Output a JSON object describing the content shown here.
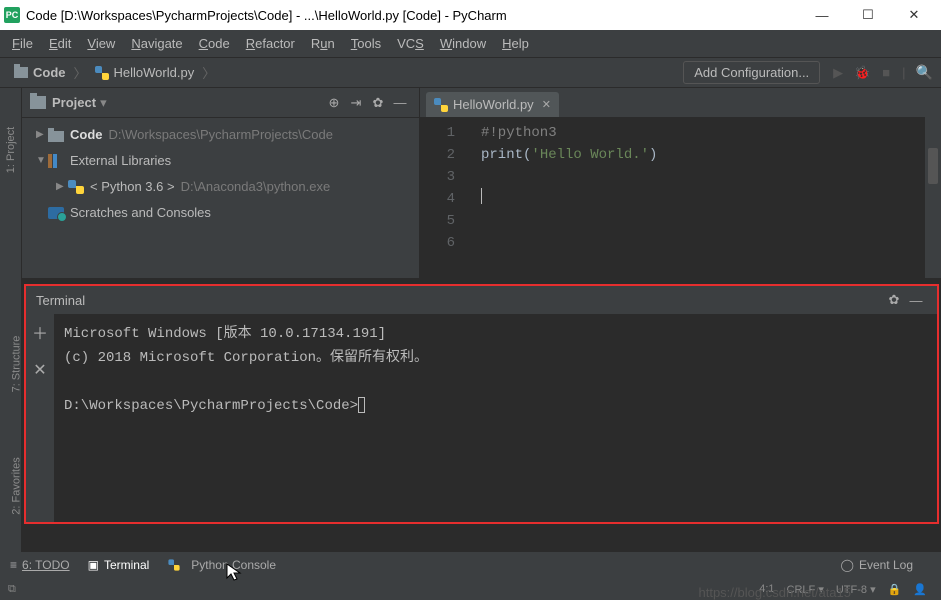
{
  "titlebar": {
    "app_badge": "PC",
    "title": "Code [D:\\Workspaces\\PycharmProjects\\Code] - ...\\HelloWorld.py [Code] - PyCharm"
  },
  "menu": [
    "File",
    "Edit",
    "View",
    "Navigate",
    "Code",
    "Refactor",
    "Run",
    "Tools",
    "VCS",
    "Window",
    "Help"
  ],
  "breadcrumb": {
    "root": "Code",
    "file": "HelloWorld.py"
  },
  "toolbar": {
    "add_config": "Add Configuration..."
  },
  "project_panel": {
    "title": "Project",
    "tree": {
      "root_name": "Code",
      "root_path": "D:\\Workspaces\\PycharmProjects\\Code",
      "ext_lib": "External Libraries",
      "python_env": "< Python 3.6 >",
      "python_path": "D:\\Anaconda3\\python.exe",
      "scratches": "Scratches and Consoles"
    }
  },
  "editor": {
    "tab": "HelloWorld.py",
    "lines": {
      "l1_comment": "#!python3",
      "l2_func": "print",
      "l2_paren_open": "(",
      "l2_str": "'Hello World.'",
      "l2_paren_close": ")"
    },
    "line_numbers": [
      "1",
      "2",
      "3",
      "4",
      "5",
      "6"
    ]
  },
  "terminal": {
    "title": "Terminal",
    "line1": "Microsoft Windows [版本 10.0.17134.191]",
    "line2": "(c) 2018 Microsoft Corporation。保留所有权利。",
    "prompt": "D:\\Workspaces\\PycharmProjects\\Code>"
  },
  "rails": {
    "project": "1: Project",
    "structure": "7: Structure",
    "favorites": "2: Favorites"
  },
  "bottom": {
    "todo": "6: TODO",
    "terminal": "Terminal",
    "pyconsole": "Python Console",
    "eventlog": "Event Log"
  },
  "status": {
    "pos": "4:1",
    "crlf": "CRLF",
    "enc": "UTF-8",
    "lock": "🔒"
  },
  "watermark": "https://blog.csdn.net/ata15"
}
